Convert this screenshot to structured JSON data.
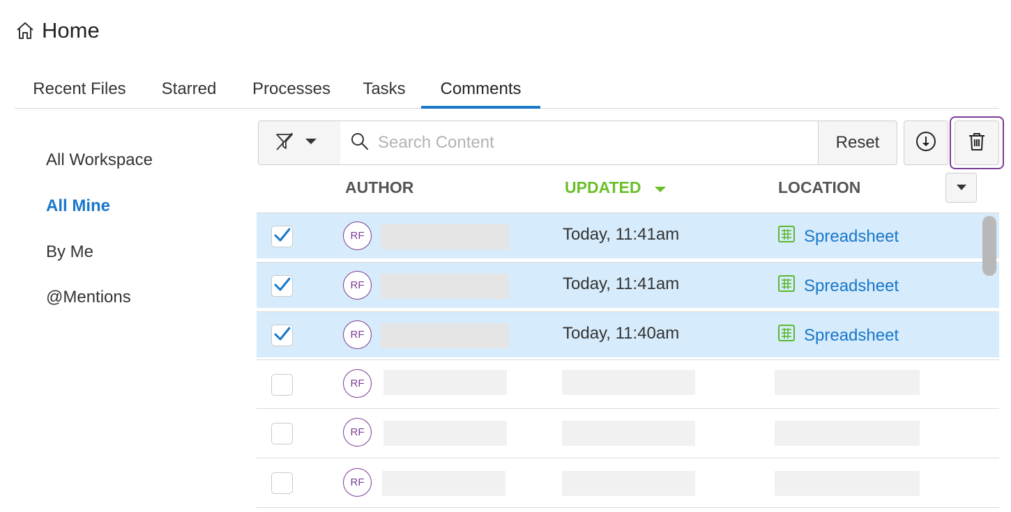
{
  "header": {
    "title": "Home",
    "icon": "home-icon"
  },
  "tabs": [
    {
      "label": "Recent Files",
      "active": false
    },
    {
      "label": "Starred",
      "active": false
    },
    {
      "label": "Processes",
      "active": false
    },
    {
      "label": "Tasks",
      "active": false
    },
    {
      "label": "Comments",
      "active": true
    }
  ],
  "leftnav": {
    "items": [
      {
        "label": "All Workspace",
        "active": false
      },
      {
        "label": "All Mine",
        "active": true
      },
      {
        "label": "By Me",
        "active": false
      },
      {
        "label": "@Mentions",
        "active": false
      }
    ]
  },
  "toolbar": {
    "filter_icon": "filter-off-icon",
    "search_placeholder": "Search Content",
    "search_value": "",
    "reset_label": "Reset",
    "download_icon": "download-icon",
    "delete_icon": "trash-icon"
  },
  "table": {
    "columns": {
      "author": "AUTHOR",
      "updated": "UPDATED",
      "location": "LOCATION"
    },
    "sort": {
      "column": "updated",
      "direction": "desc"
    },
    "rows": [
      {
        "checked": true,
        "initials": "RF",
        "updated": "Today, 11:41am",
        "location": "Spreadsheet"
      },
      {
        "checked": true,
        "initials": "RF",
        "updated": "Today, 11:41am",
        "location": "Spreadsheet"
      },
      {
        "checked": true,
        "initials": "RF",
        "updated": "Today, 11:40am",
        "location": "Spreadsheet"
      },
      {
        "checked": false,
        "initials": "RF",
        "updated": "",
        "location": ""
      },
      {
        "checked": false,
        "initials": "RF",
        "updated": "",
        "location": ""
      },
      {
        "checked": false,
        "initials": "RF",
        "updated": "",
        "location": ""
      }
    ]
  },
  "colors": {
    "accent": "#1877c9",
    "sorted_header": "#6abf2a",
    "selected_row": "#d6ebfb",
    "avatar": "#7b3a96",
    "spreadsheet_icon": "#5cb82e"
  }
}
